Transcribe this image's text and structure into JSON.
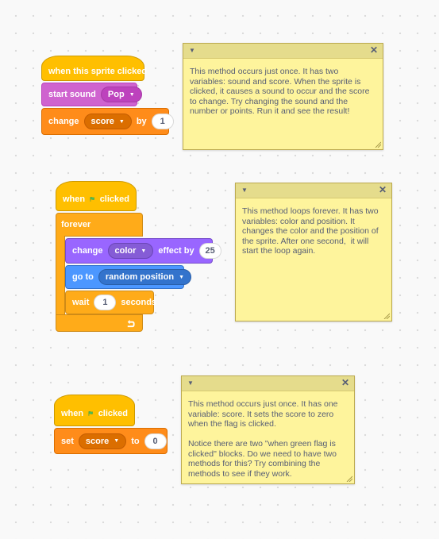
{
  "script1": {
    "hat": {
      "label": "when this sprite clicked"
    },
    "start_sound": {
      "label": "start sound",
      "sound": "Pop"
    },
    "change_score": {
      "label": "change",
      "variable": "score",
      "by_label": "by",
      "value": "1"
    }
  },
  "note1": {
    "text": "This method occurs just once. It has two variables: sound and score. When the sprite is clicked, it causes a sound to occur and the score to change. Try changing the sound and the number or points. Run it and see the result!"
  },
  "script2": {
    "hat": {
      "label_when": "when",
      "label_clicked": "clicked"
    },
    "forever": {
      "label": "forever"
    },
    "change_effect": {
      "label": "change",
      "effect": "color",
      "by_label": "effect by",
      "value": "25"
    },
    "go_to": {
      "label": "go to",
      "target": "random position"
    },
    "wait": {
      "label": "wait",
      "value": "1",
      "unit": "seconds"
    }
  },
  "note2": {
    "text": "This method loops forever. It has two variables: color and position. It changes the color and the position of the sprite. After one second,  it will start the loop again."
  },
  "script3": {
    "hat": {
      "label_when": "when",
      "label_clicked": "clicked"
    },
    "set_score": {
      "label": "set",
      "variable": "score",
      "to_label": "to",
      "value": "0"
    }
  },
  "note3": {
    "text": "This method occurs just once. It has one variable: score. It sets the score to zero when the flag is clicked.\n\nNotice there are two \"when green flag is clicked\" blocks. Do we need to have two methods for this? Try combining the methods to see if they work."
  },
  "colors": {
    "events": "#ffbf00",
    "sound": "#cf63cf",
    "variables": "#ff8c1a",
    "control": "#ffab19",
    "looks": "#9966ff",
    "motion": "#4c97ff",
    "note": "#fef49c",
    "flag": "#4cbf56"
  },
  "icons": {
    "flag": "green-flag-icon",
    "loop_arrow": "loop-arrow-icon",
    "collapse": "triangle-down-icon",
    "close": "close-icon",
    "resize": "resize-grip-icon"
  }
}
